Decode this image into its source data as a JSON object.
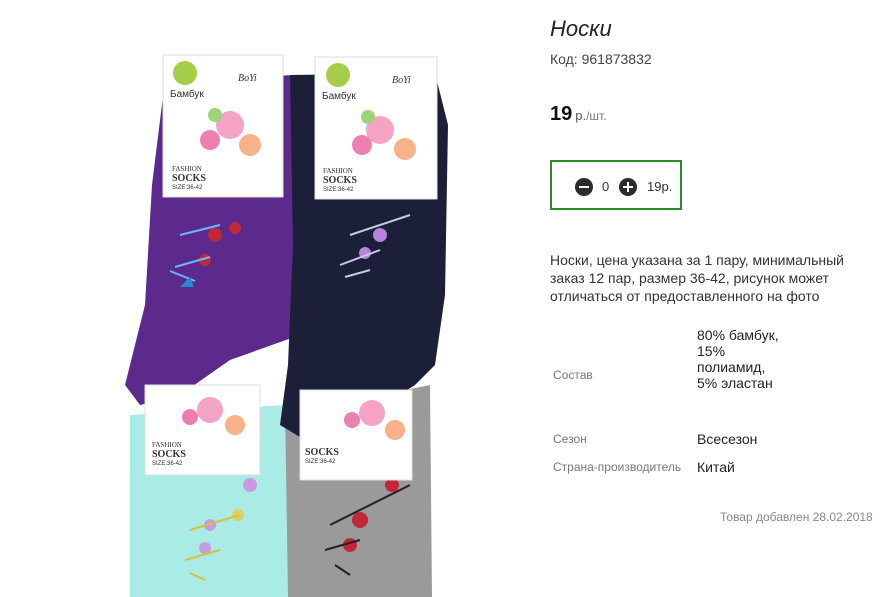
{
  "product": {
    "title": "Носки",
    "code": "Код: 961873832",
    "price": {
      "value": "19",
      "currency": "р.",
      "unit": "/шт."
    },
    "description": "Носки, цена указана за 1 пару, минимальный заказ 12 пар, размер 36-42, рисунок может отличаться от предоставленного на фото",
    "added": "Товар добавлен 28.02.2018"
  },
  "cart": {
    "quantity": "0",
    "sum": "19р.",
    "border_color": "#2d8a2d"
  },
  "specs": [
    {
      "label": "Состав",
      "value": "80% бамбук, 15% полиамид, 5% эластан"
    },
    {
      "label": "Сезон",
      "value": "Всесезон"
    },
    {
      "label": "Страна-производитель",
      "value": "Китай"
    }
  ],
  "photo": {
    "brand_text": "Бамбук",
    "logo_text": "BoYi",
    "fashion_text": "FASHION",
    "socks_text": "SOCKS",
    "size_text": "SIZE:36-42",
    "sock_colors": {
      "purple": "#5b2a8c",
      "navy": "#1b2038",
      "mint": "#a9ece6",
      "grey": "#9a9a9a"
    }
  }
}
